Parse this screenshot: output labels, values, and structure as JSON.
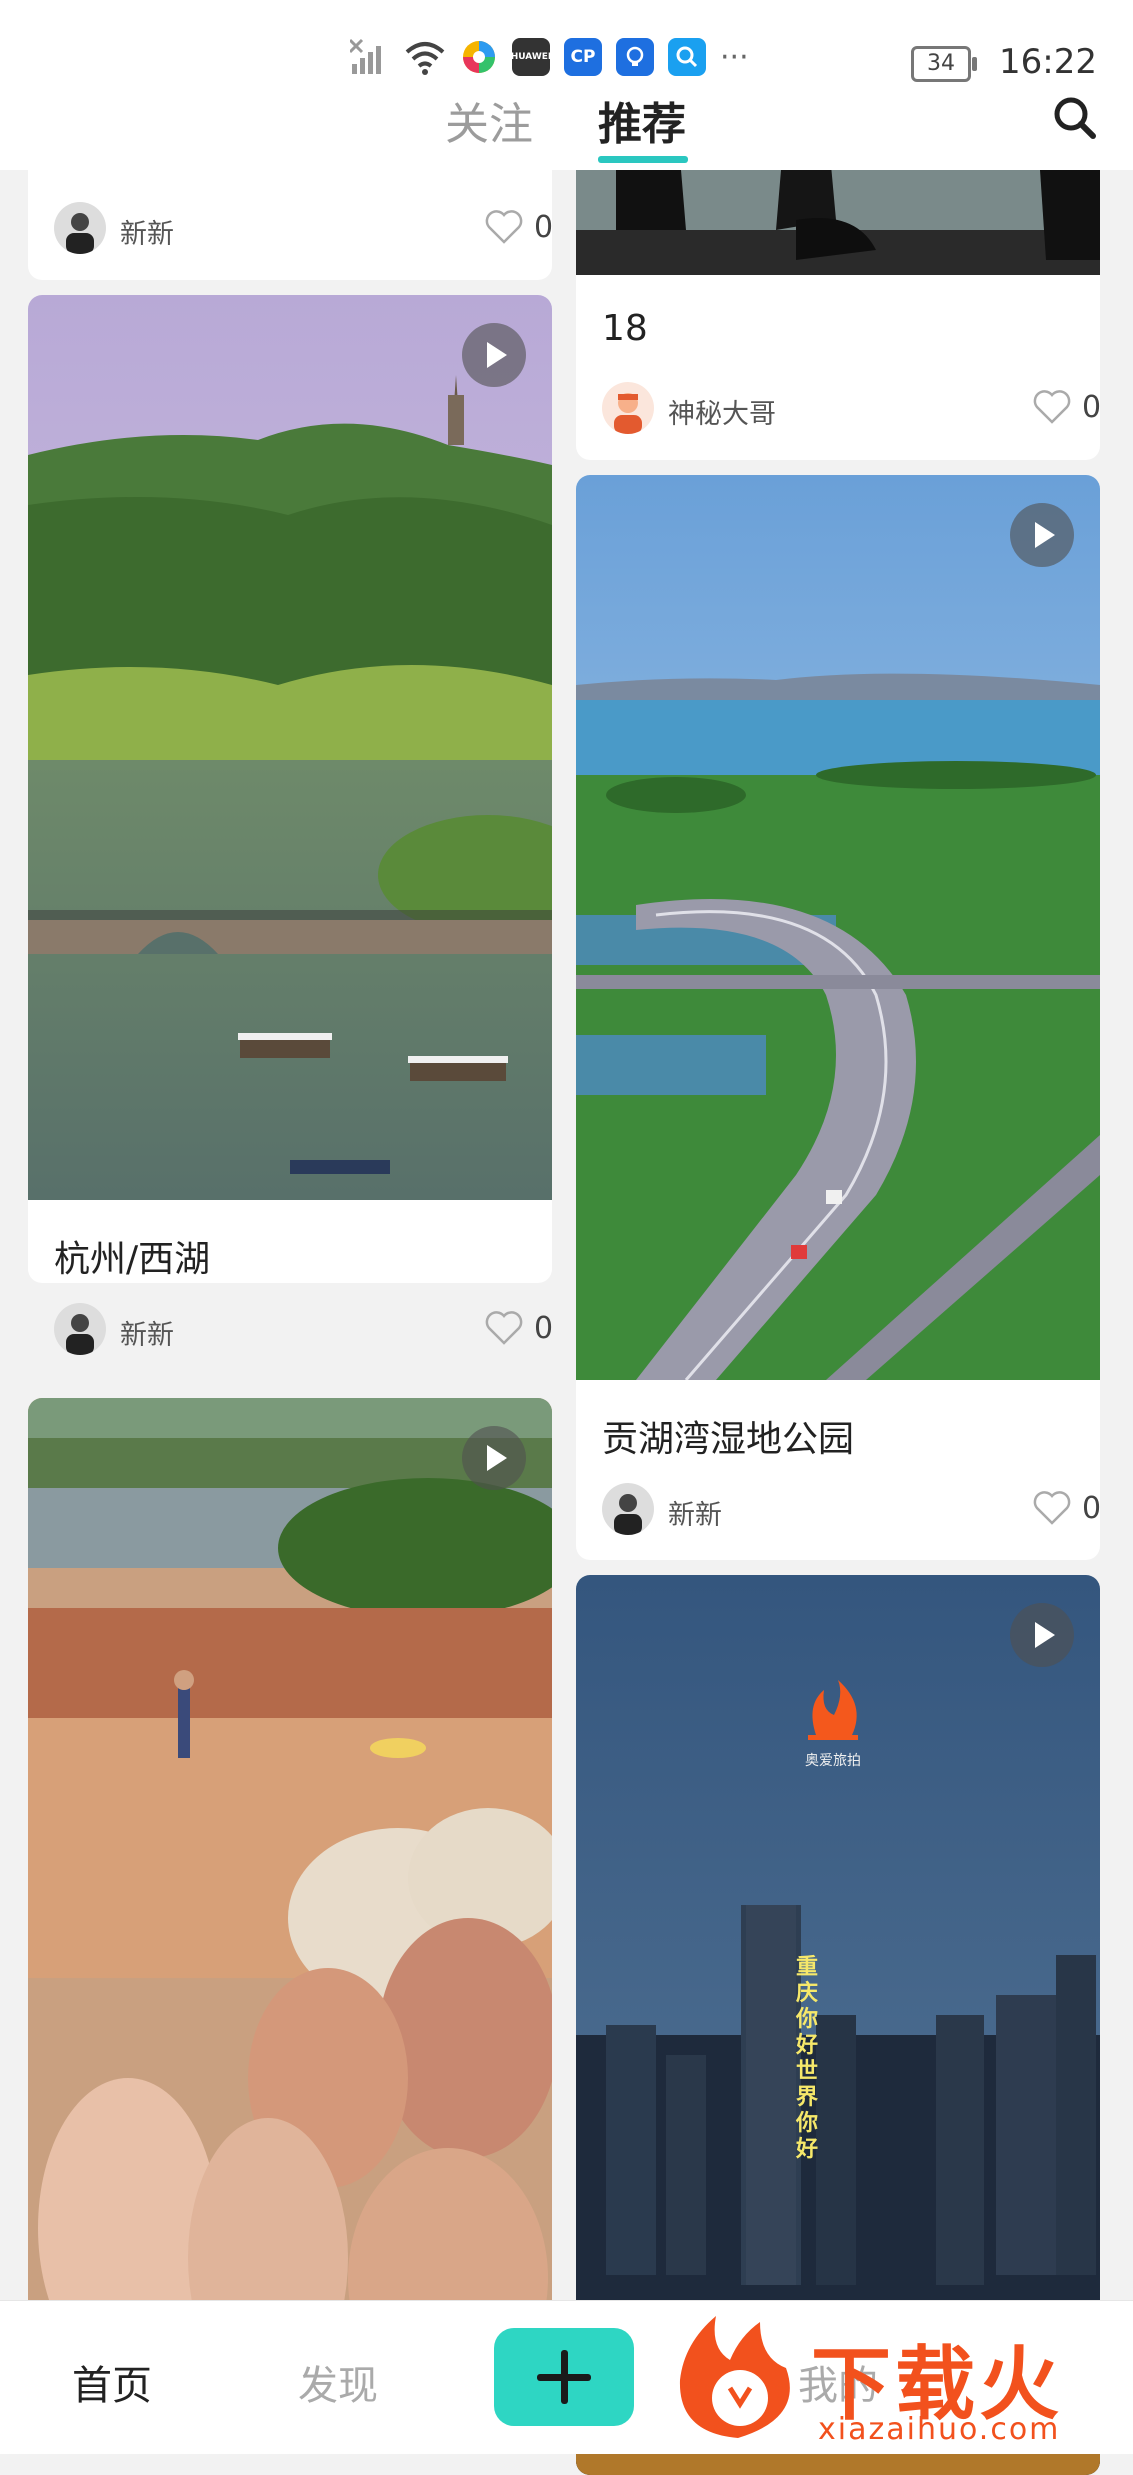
{
  "status_bar": {
    "time": "16:22",
    "battery": "34",
    "more": "···",
    "app_icons": [
      {
        "name": "huawei-app-icon",
        "label": "HUAWEI",
        "color": "#333333"
      },
      {
        "name": "cp-app-icon",
        "label": "CP",
        "color": "#1e6fe0"
      },
      {
        "name": "bulb-app-icon",
        "label": "",
        "color": "#1e6fe0"
      },
      {
        "name": "search-app-icon",
        "label": "",
        "color": "#1aa0f0"
      }
    ]
  },
  "top_nav": {
    "tabs": [
      {
        "label": "关注",
        "active": false
      },
      {
        "label": "推荐",
        "active": true
      }
    ],
    "accent": "#2ac7c0"
  },
  "feed": {
    "left": [
      {
        "title": "",
        "author": "新新",
        "likes": "0",
        "has_video": false
      },
      {
        "title": "杭州/西湖",
        "author": "新新",
        "likes": "0",
        "has_video": true
      },
      {
        "title": "",
        "author": "",
        "likes": "",
        "has_video": true
      }
    ],
    "right": [
      {
        "title": "18",
        "author": "神秘大哥",
        "likes": "0",
        "has_video": false
      },
      {
        "title": "贡湖湾湿地公园",
        "author": "新新",
        "likes": "0",
        "has_video": true
      },
      {
        "title": "",
        "author": "",
        "likes": "",
        "has_video": true
      }
    ],
    "neon_sign": "重庆你好 世界你好",
    "logo_caption": "奥爱旅拍"
  },
  "bottom_nav": {
    "home": "首页",
    "discover": "发现",
    "add": "+",
    "profile": "我的"
  },
  "watermark": {
    "brand": "下载火",
    "url": "xiazaihuo.com"
  }
}
